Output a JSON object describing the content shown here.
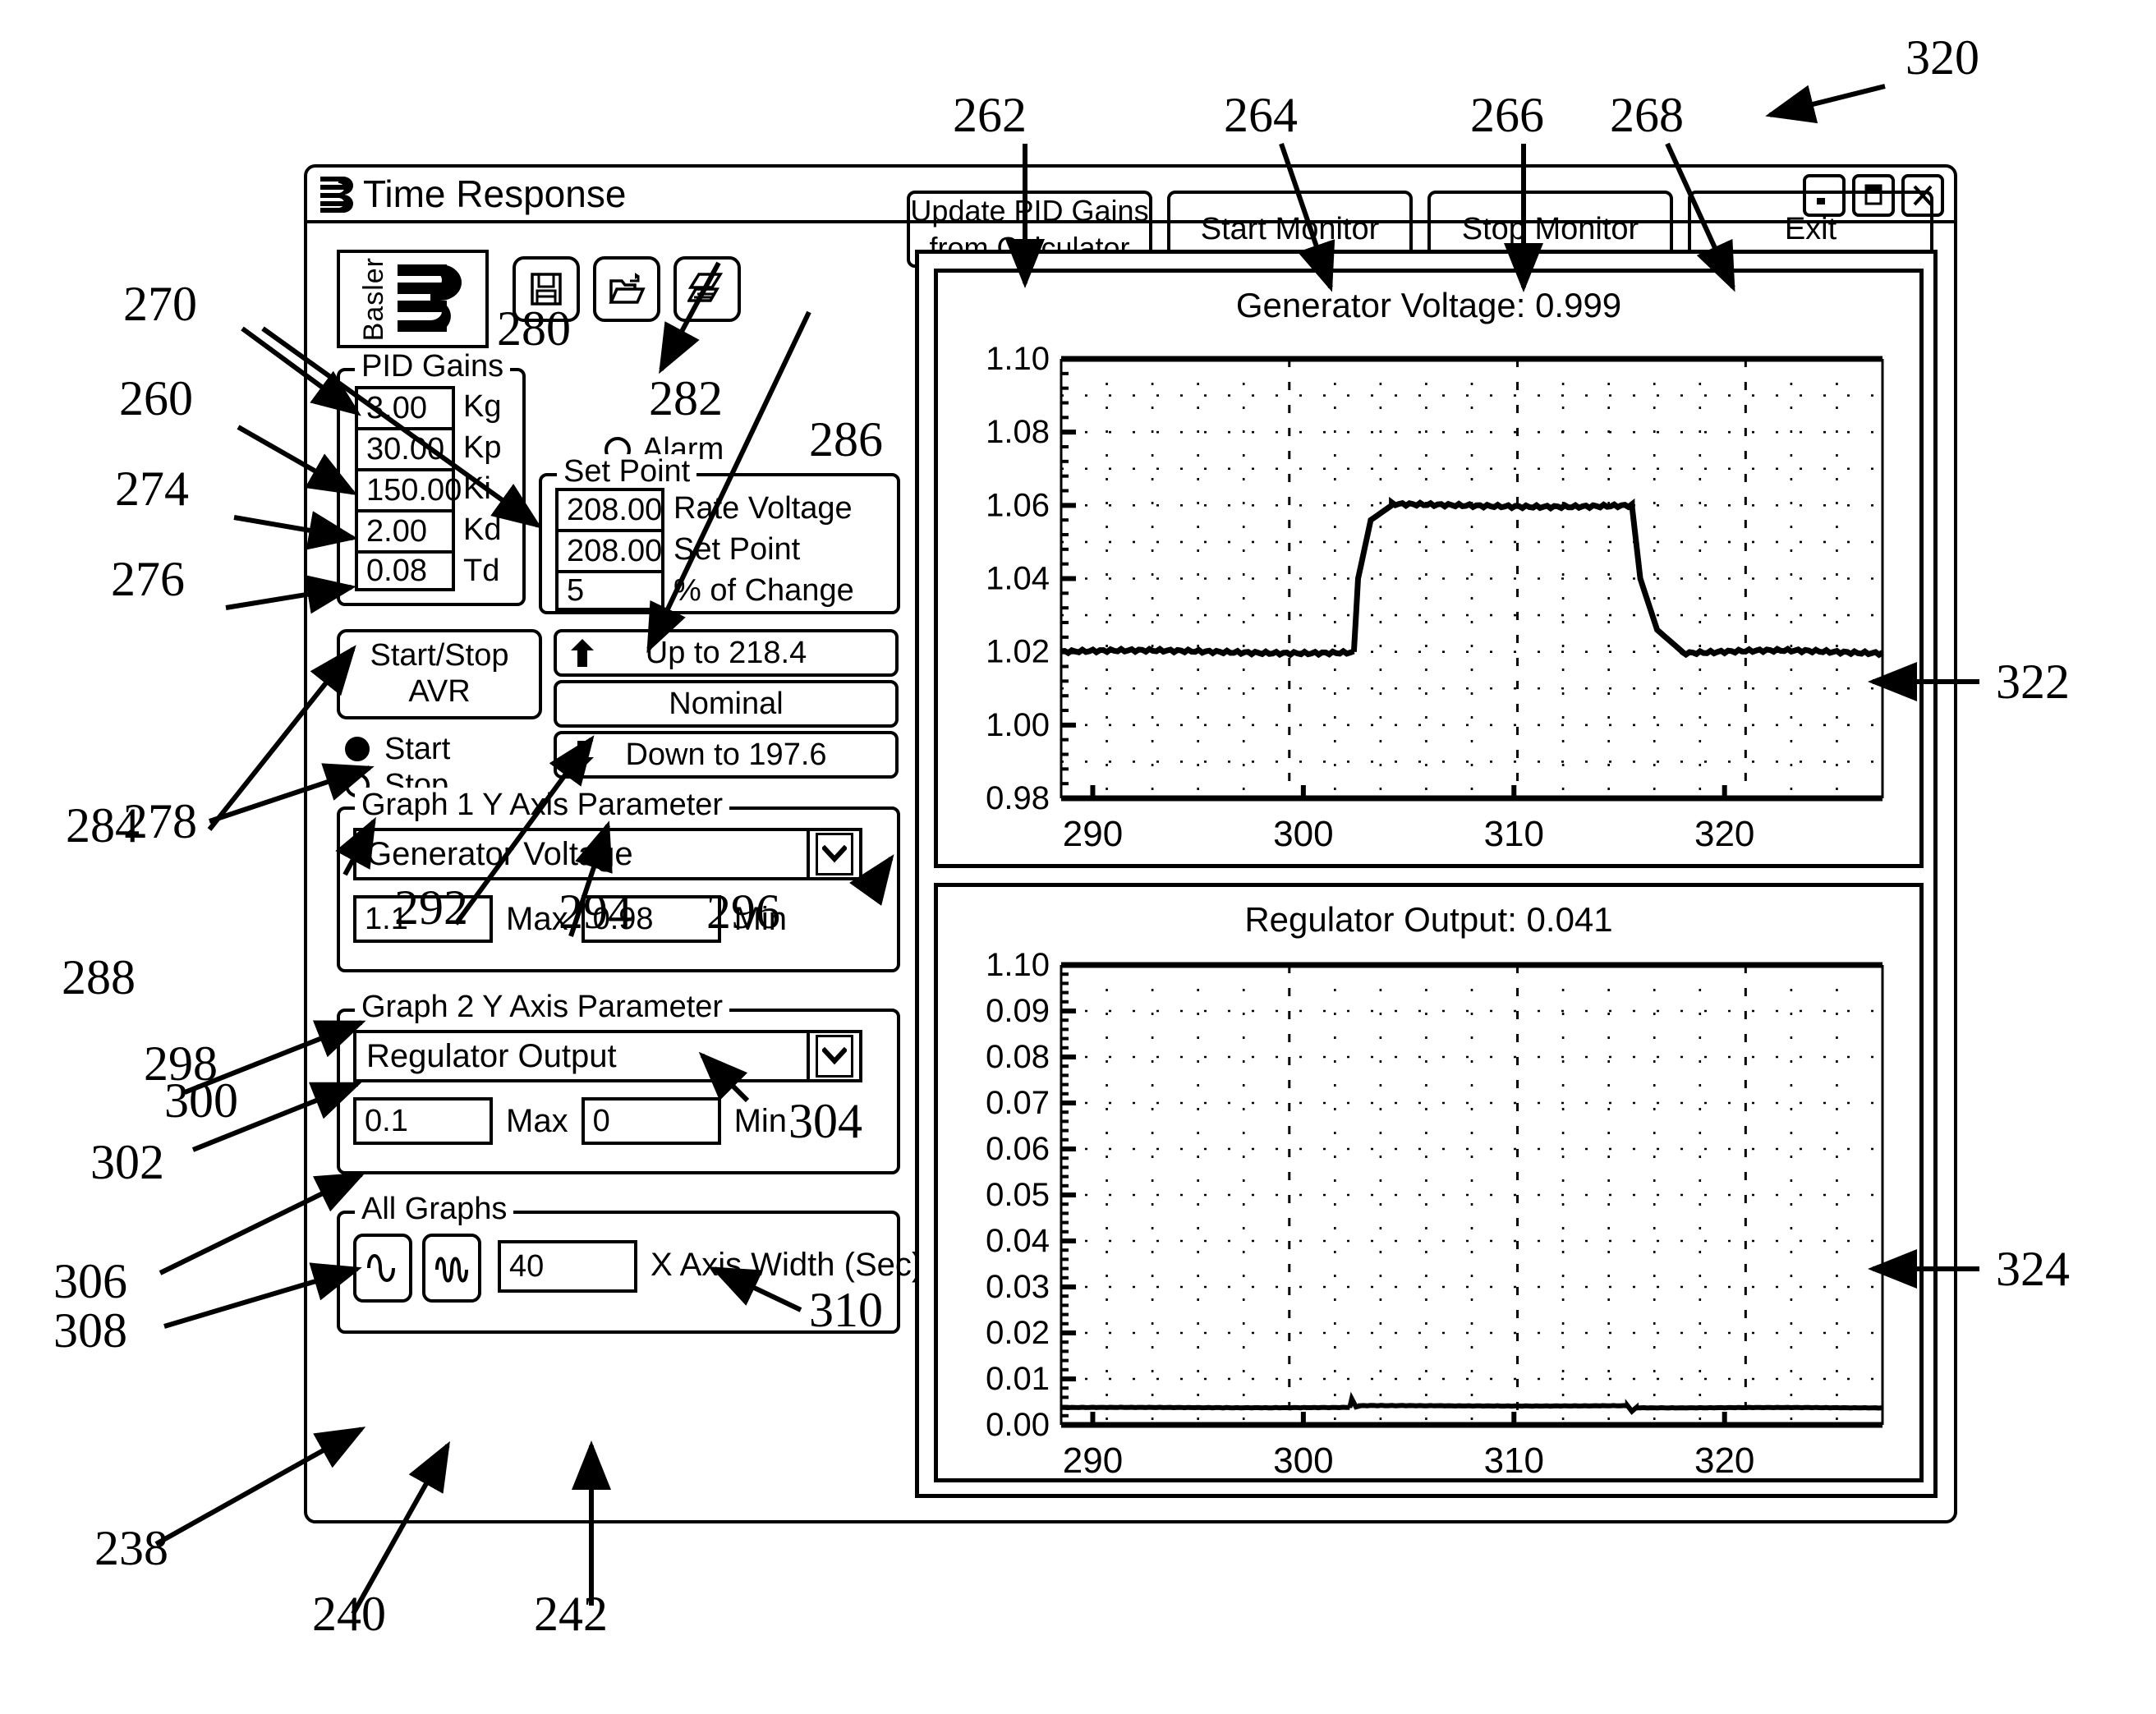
{
  "window": {
    "title": "Time Response",
    "logo_icon": "basler-b-icon",
    "controls": [
      {
        "name": "minimize",
        "icon": "minimize-icon"
      },
      {
        "name": "maximize",
        "icon": "maximize-icon"
      },
      {
        "name": "close",
        "icon": "close-icon"
      }
    ]
  },
  "brand": {
    "name": "Basler"
  },
  "toolbar": {
    "buttons": [
      {
        "name": "save",
        "icon": "floppy-disk-icon"
      },
      {
        "name": "open",
        "icon": "open-folder-icon"
      },
      {
        "name": "print",
        "icon": "printer-icon"
      }
    ]
  },
  "top_buttons": [
    {
      "label": "Update PID Gains\nfrom Calculator",
      "line1": "Update PID Gains",
      "line2": "from Calculator"
    },
    {
      "label": "Start Monitor"
    },
    {
      "label": "Stop Monitor"
    },
    {
      "label": "Exit"
    }
  ],
  "pid_gains": {
    "legend": "PID Gains",
    "rows": [
      {
        "value": "3.00",
        "label": "Kg"
      },
      {
        "value": "30.00",
        "label": "Kp"
      },
      {
        "value": "150.00",
        "label": "Ki"
      },
      {
        "value": "2.00",
        "label": "Kd"
      },
      {
        "value": "0.08",
        "label": "Td"
      }
    ]
  },
  "alarm": {
    "label": "Alarm",
    "state": "off"
  },
  "set_point": {
    "legend": "Set Point",
    "rows": [
      {
        "value": "208.00",
        "label": "Rate Voltage"
      },
      {
        "value": "208.00",
        "label": "Set Point"
      },
      {
        "value": "5",
        "label": "% of Change"
      }
    ]
  },
  "avr": {
    "button_line1": "Start/Stop",
    "button_line2": "AVR",
    "radios": [
      {
        "label": "Start",
        "selected": true
      },
      {
        "label": "Stop",
        "selected": false
      }
    ]
  },
  "step_buttons": [
    {
      "label": "Up to 218.4",
      "icon": "arrow-up-icon"
    },
    {
      "label": "Nominal",
      "icon": ""
    },
    {
      "label": "Down to 197.6",
      "icon": "arrow-down-icon"
    }
  ],
  "graph1_param": {
    "legend": "Graph 1 Y Axis Parameter",
    "selected": "Generator Voltage",
    "max_value": "1.1",
    "max_label": "Max",
    "min_value": "0.98",
    "min_label": "Min"
  },
  "graph2_param": {
    "legend": "Graph 2 Y Axis Parameter",
    "selected": "Regulator Output",
    "max_value": "0.1",
    "max_label": "Max",
    "min_value": "0",
    "min_label": "Min"
  },
  "all_graphs": {
    "legend": "All Graphs",
    "icon1": "single-wave-icon",
    "icon2": "multi-wave-icon",
    "x_axis_width_value": "40",
    "x_axis_width_label": "X Axis Width (Sec)"
  },
  "chart_data": [
    {
      "type": "line",
      "title": "Generator Voltage: 0.999",
      "readout": "0.999",
      "parameter": "Generator Voltage",
      "xlabel": "",
      "ylabel": "",
      "xlim": [
        288.5,
        327.5
      ],
      "ylim": [
        0.98,
        1.1
      ],
      "xticks": [
        290,
        300,
        310,
        320
      ],
      "yticks": [
        0.98,
        1.0,
        1.02,
        1.04,
        1.06,
        1.08,
        1.1
      ],
      "ytick_labels": [
        "0.98",
        "1.00",
        "1.02",
        "1.04",
        "1.06",
        "1.08",
        "1.10"
      ],
      "grid": "dotted",
      "legend": "none",
      "series": [
        {
          "name": "Generator Voltage",
          "x": [
            288.5,
            302.4,
            302.6,
            303.2,
            304.2,
            315.6,
            316.0,
            316.8,
            318.0,
            327.5
          ],
          "y": [
            1.02,
            1.02,
            1.04,
            1.056,
            1.06,
            1.06,
            1.04,
            1.026,
            1.02,
            1.02
          ]
        }
      ]
    },
    {
      "type": "line",
      "title": "Regulator Output: 0.041",
      "readout": "0.041",
      "parameter": "Regulator Output",
      "xlabel": "",
      "ylabel": "",
      "xlim": [
        288.5,
        327.5
      ],
      "ylim": [
        0.0,
        1.1
      ],
      "xticks": [
        290,
        300,
        310,
        320
      ],
      "yticks": [
        0.0,
        0.01,
        0.02,
        0.03,
        0.04,
        0.05,
        0.06,
        0.07,
        0.08,
        0.09,
        1.1
      ],
      "ytick_labels": [
        "0.00",
        "0.01",
        "0.02",
        "0.03",
        "0.04",
        "0.05",
        "0.06",
        "0.07",
        "0.08",
        "0.09",
        "1.10"
      ],
      "grid": "dotted",
      "legend": "none",
      "series": [
        {
          "name": "Regulator Output",
          "x": [
            288.5,
            302.2,
            302.3,
            302.5,
            302.7,
            303.2,
            315.4,
            315.6,
            315.8,
            316.0,
            327.5
          ],
          "y": [
            0.0415,
            0.0415,
            0.0625,
            0.043,
            0.0455,
            0.0458,
            0.0455,
            0.0325,
            0.041,
            0.0412,
            0.0412
          ]
        }
      ]
    }
  ],
  "callouts": [
    {
      "num": "320"
    },
    {
      "num": "262"
    },
    {
      "num": "264"
    },
    {
      "num": "266"
    },
    {
      "num": "268"
    },
    {
      "num": "270"
    },
    {
      "num": "260"
    },
    {
      "num": "274"
    },
    {
      "num": "276"
    },
    {
      "num": "278"
    },
    {
      "num": "280"
    },
    {
      "num": "282"
    },
    {
      "num": "286"
    },
    {
      "num": "284"
    },
    {
      "num": "288"
    },
    {
      "num": "298"
    },
    {
      "num": "292"
    },
    {
      "num": "294"
    },
    {
      "num": "296"
    },
    {
      "num": "300"
    },
    {
      "num": "302"
    },
    {
      "num": "304"
    },
    {
      "num": "306"
    },
    {
      "num": "308"
    },
    {
      "num": "310"
    },
    {
      "num": "238"
    },
    {
      "num": "240"
    },
    {
      "num": "242"
    },
    {
      "num": "322"
    },
    {
      "num": "324"
    }
  ]
}
